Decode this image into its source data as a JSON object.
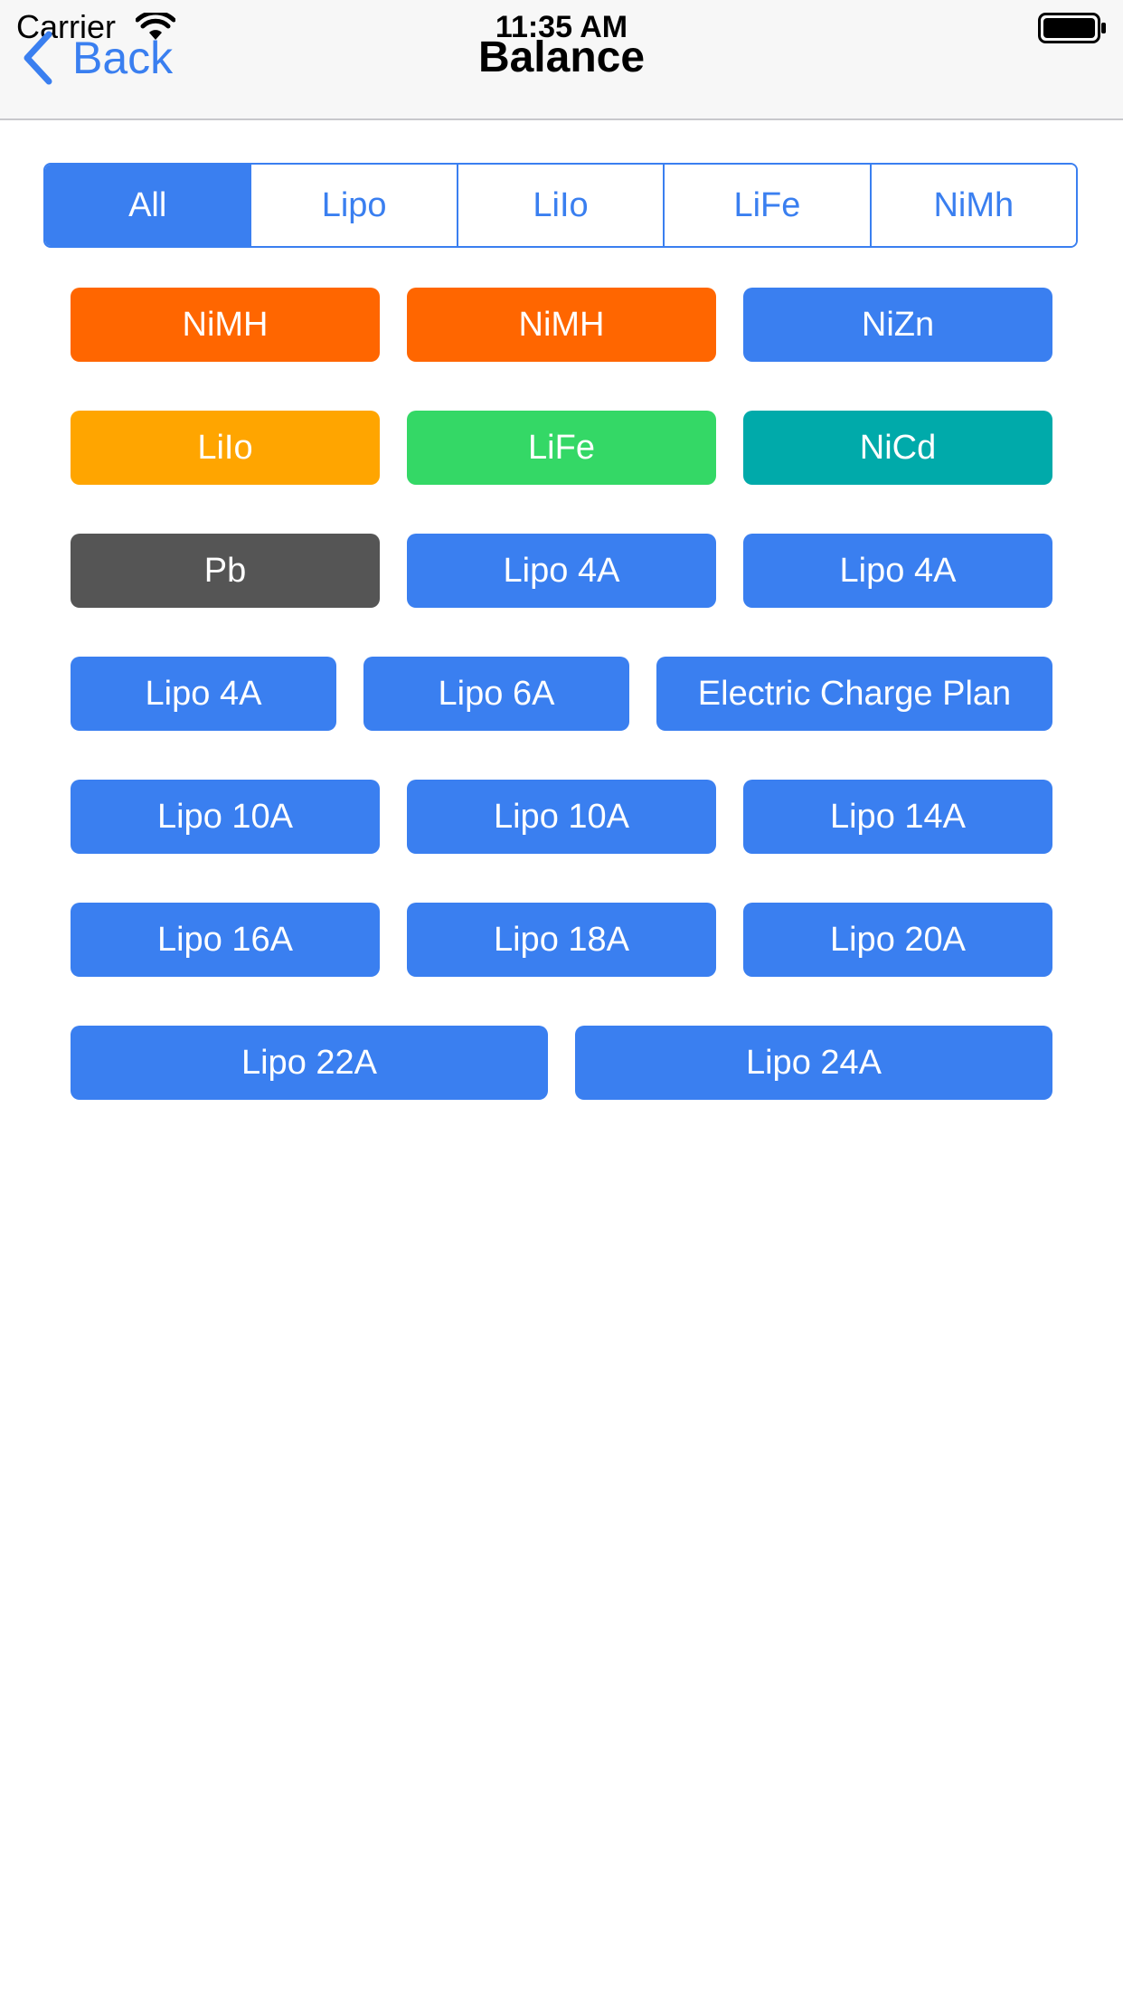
{
  "status_bar": {
    "carrier": "Carrier",
    "time": "11:35 AM",
    "wifi_icon": "wifi-icon",
    "battery_icon": "battery-icon"
  },
  "nav": {
    "back_label": "Back",
    "back_icon": "chevron-left-icon",
    "title": "Balance"
  },
  "segments": [
    {
      "label": "All",
      "selected": true
    },
    {
      "label": "Lipo",
      "selected": false
    },
    {
      "label": "LiIo",
      "selected": false
    },
    {
      "label": "LiFe",
      "selected": false
    },
    {
      "label": "NiMh",
      "selected": false
    }
  ],
  "colors": {
    "accent": "#3a7ff0",
    "orange": "#ff6600",
    "amber": "#ffa500",
    "green": "#34d866",
    "teal": "#00aaaa",
    "dark_gray": "#555555",
    "blue": "#3a7ff0"
  },
  "buttons": [
    {
      "label": "NiMH",
      "color": "#ff6600"
    },
    {
      "label": "NiMH",
      "color": "#ff6600"
    },
    {
      "label": "NiZn",
      "color": "#3a7ff0"
    },
    {
      "label": "LiIo",
      "color": "#ffa500"
    },
    {
      "label": "LiFe",
      "color": "#34d866"
    },
    {
      "label": "NiCd",
      "color": "#00aaaa"
    },
    {
      "label": "Pb",
      "color": "#555555"
    },
    {
      "label": "Lipo 4A",
      "color": "#3a7ff0"
    },
    {
      "label": "Lipo 4A",
      "color": "#3a7ff0"
    },
    {
      "label": "Lipo 4A",
      "color": "#3a7ff0"
    },
    {
      "label": "Lipo 6A",
      "color": "#3a7ff0"
    },
    {
      "label": "Electric Charge Plan",
      "color": "#3a7ff0"
    },
    {
      "label": "Lipo 10A",
      "color": "#3a7ff0"
    },
    {
      "label": "Lipo 10A",
      "color": "#3a7ff0"
    },
    {
      "label": "Lipo 14A",
      "color": "#3a7ff0"
    },
    {
      "label": "Lipo 16A",
      "color": "#3a7ff0"
    },
    {
      "label": "Lipo 18A",
      "color": "#3a7ff0"
    },
    {
      "label": "Lipo 20A",
      "color": "#3a7ff0"
    },
    {
      "label": "Lipo 22A",
      "color": "#3a7ff0"
    },
    {
      "label": "Lipo 24A",
      "color": "#3a7ff0"
    }
  ]
}
